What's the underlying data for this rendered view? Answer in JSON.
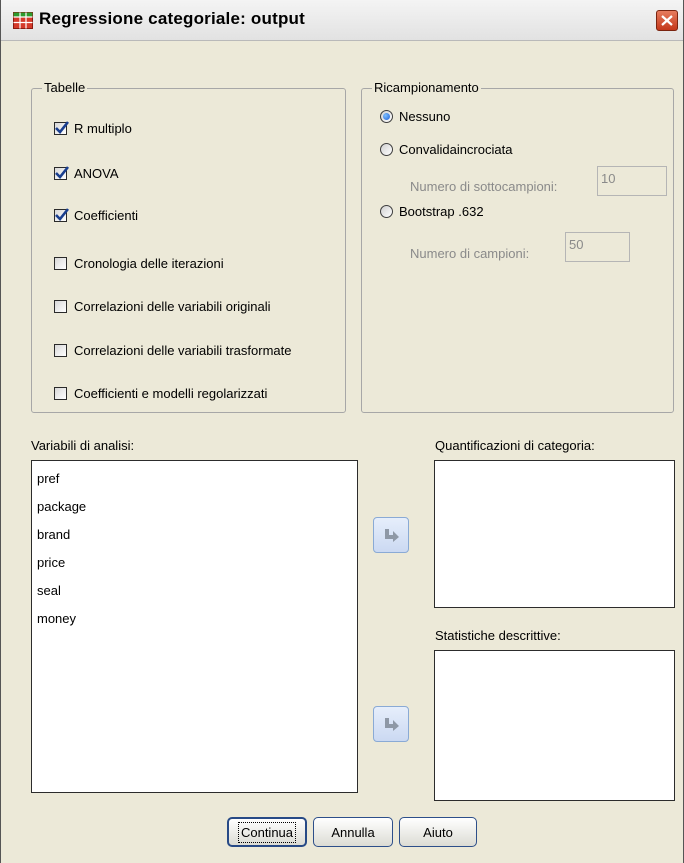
{
  "window": {
    "title": "Regressione categoriale: output"
  },
  "tables": {
    "legend": "Tabelle",
    "items": [
      {
        "label": "R multiplo",
        "checked": true
      },
      {
        "label": "ANOVA",
        "checked": true
      },
      {
        "label": "Coefficienti",
        "checked": true
      },
      {
        "label": "Cronologia delle iterazioni",
        "checked": false
      },
      {
        "label": "Correlazioni delle variabili originali",
        "checked": false
      },
      {
        "label": "Correlazioni delle variabili trasformate",
        "checked": false
      },
      {
        "label": "Coefficienti e modelli regolarizzati",
        "checked": false
      }
    ]
  },
  "resampling": {
    "legend": "Ricampionamento",
    "options": [
      {
        "label": "Nessuno",
        "selected": true
      },
      {
        "label": "Convalidaincrociata",
        "selected": false
      },
      {
        "label": "Bootstrap .632",
        "selected": false
      }
    ],
    "subsamples_label": "Numero di sottocampioni:",
    "subsamples_value": "10",
    "samples_label": "Numero di campioni:",
    "samples_value": "50"
  },
  "analysis_vars": {
    "label": "Variabili di analisi:",
    "items": [
      "pref",
      "package",
      "brand",
      "price",
      "seal",
      "money"
    ]
  },
  "quantifications": {
    "label": "Quantificazioni di categoria:"
  },
  "descriptives": {
    "label": "Statistiche descrittive:"
  },
  "buttons": {
    "continue": "Continua",
    "cancel": "Annulla",
    "help": "Aiuto"
  },
  "icons": {
    "app": "grid-table-icon",
    "close": "close-icon",
    "move": "arrow-right-icon",
    "check": "checkmark-icon"
  },
  "colors": {
    "check": "#1a3f8f",
    "radio_dot": "#1f5fd6",
    "close": "#c4371a"
  }
}
